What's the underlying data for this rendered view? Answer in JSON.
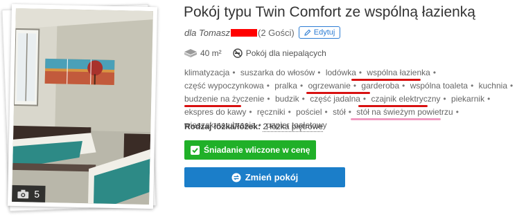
{
  "room": {
    "title": "Pokój typu Twin Comfort ze wspólną łazienką",
    "guest_prefix": "dla Tomasz",
    "guest_count": "(2 Gości)",
    "edit_label": "Edytuj",
    "area": "40 m²",
    "smoking": "Pokój dla niepalących",
    "photo_count": "5"
  },
  "amenities": [
    "klimatyzacja",
    "suszarka do włosów",
    "lodówka",
    "wspólna łazienka",
    "część wypoczynkowa",
    "pralka",
    "ogrzewanie",
    "garderoba",
    "wspólna toaleta",
    "kuchnia",
    "budzenie na życzenie",
    "budzik",
    "część jadalna",
    "czajnik elektryczny",
    "piekarnik",
    "ekspres do kawy",
    "ręczniki",
    "pościel",
    "stół",
    "stół na świeżym powietrzu",
    "wieszak na ubrania",
    "papier toaletowy"
  ],
  "bed": {
    "label": "Rodzaj łóżka/łóżek:",
    "value": "2 łóżka piętrowe"
  },
  "buttons": {
    "breakfast": "Śniadanie wliczone w cenę",
    "change_room": "Zmień pokój"
  },
  "colors": {
    "breakfast_green": "#20b028",
    "primary_blue": "#1b7ec9",
    "annotation_red": "#d81010",
    "annotation_pink": "#f19ac0"
  }
}
